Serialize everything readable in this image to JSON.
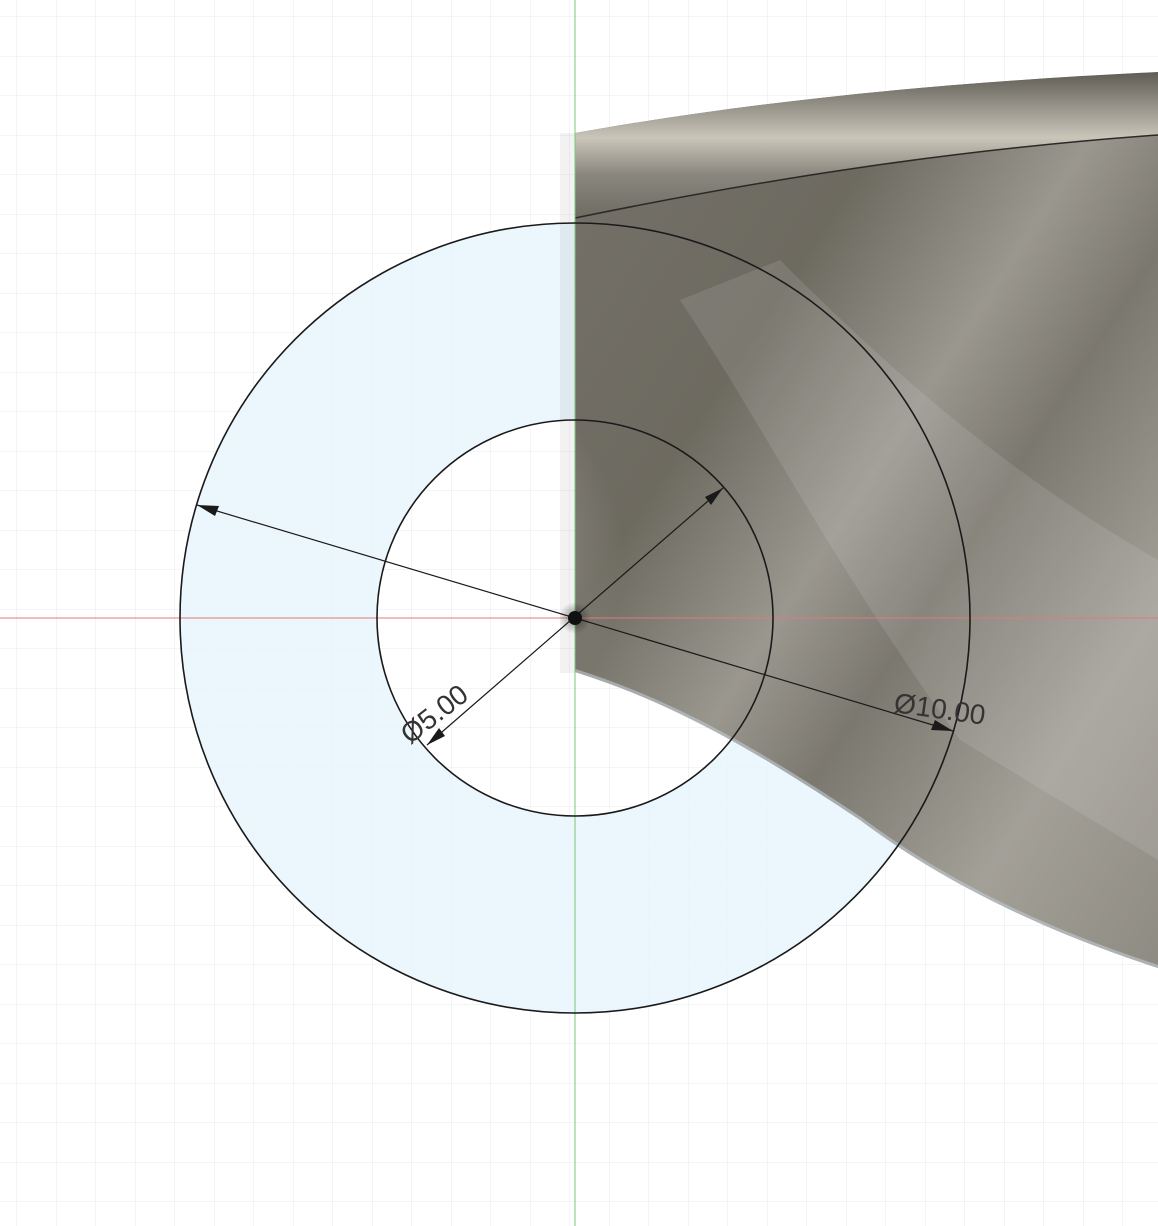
{
  "sketch": {
    "outer_diameter_label": "Ø10.00",
    "inner_diameter_label": "Ø5.00"
  },
  "colors": {
    "background": "#ffffff",
    "grid_line": "#e3e8ec",
    "x_axis": "#e06a6a",
    "y_axis": "#6cc46c",
    "profile_fill": "#d4e9fb",
    "sketch_line": "#1a1a1a",
    "body_dark": "#6f6b60",
    "body_mid": "#8d897d",
    "body_light": "#a9a69d",
    "edge_highlight": "#c6c2b6"
  },
  "icons": {
    "sketch_origin": "origin-point-icon"
  }
}
